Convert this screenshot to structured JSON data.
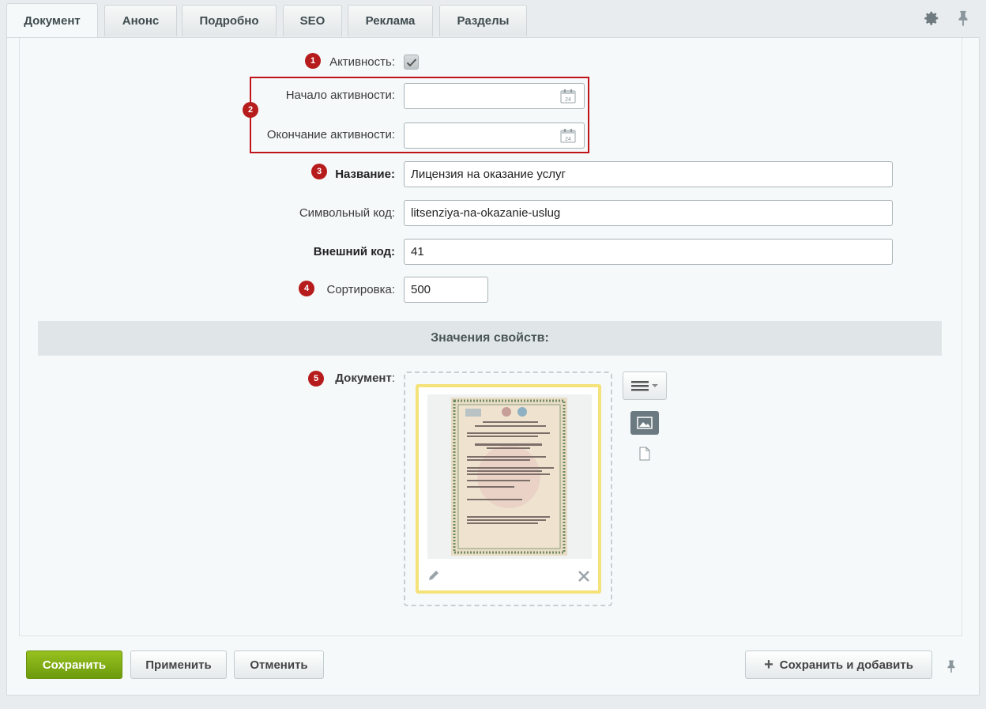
{
  "tabs": [
    "Документ",
    "Анонс",
    "Подробно",
    "SEO",
    "Реклама",
    "Разделы"
  ],
  "form": {
    "activity_label": "Активность:",
    "active_checked": true,
    "start_label": "Начало активности:",
    "start_value": "",
    "end_label": "Окончание активности:",
    "end_value": "",
    "name_label": "Название:",
    "name_value": "Лицензия на оказание услуг",
    "code_label": "Символьный код:",
    "code_value": "litsenziya-na-okazanie-uslug",
    "xml_label": "Внешний код:",
    "xml_value": "41",
    "sort_label": "Сортировка:",
    "sort_value": "500",
    "section_title": "Значения свойств:",
    "document_label": "Документ",
    "document_colon": ":"
  },
  "badges": [
    "1",
    "2",
    "3",
    "4",
    "5"
  ],
  "calendar_icon_text": "24",
  "buttons": {
    "save": "Сохранить",
    "apply": "Применить",
    "cancel": "Отменить",
    "save_add": "Сохранить и добавить"
  },
  "colors": {
    "accent_green": "#7aab12",
    "annotation_red": "#b71c1c",
    "highlight_yellow": "#f5e27a"
  }
}
